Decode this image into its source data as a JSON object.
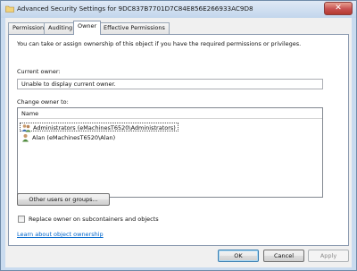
{
  "window": {
    "title": "Advanced Security Settings for 9DC837B7701D7C84E856E266933AC9D8",
    "close_label": "✕"
  },
  "tabs": [
    {
      "label": "Permissions"
    },
    {
      "label": "Auditing"
    },
    {
      "label": "Owner"
    },
    {
      "label": "Effective Permissions"
    }
  ],
  "owner_tab": {
    "intro": "You can take or assign ownership of this object if you have the required permissions or privileges.",
    "current_owner_label": "Current owner:",
    "current_owner_value": "Unable to display current owner.",
    "change_owner_label": "Change owner to:",
    "list_header": "Name",
    "list_items": [
      {
        "label": "Administrators (eMachinesT6520\\Administrators)",
        "icon": "group-icon"
      },
      {
        "label": "Alan (eMachinesT6520\\Alan)",
        "icon": "user-icon"
      }
    ],
    "other_users_button": "Other users or groups...",
    "replace_owner_checkbox": "Replace owner on subcontainers and objects",
    "replace_owner_checked": false,
    "learn_link": "Learn about object ownership"
  },
  "footer": {
    "ok": "OK",
    "cancel": "Cancel",
    "apply": "Apply"
  }
}
